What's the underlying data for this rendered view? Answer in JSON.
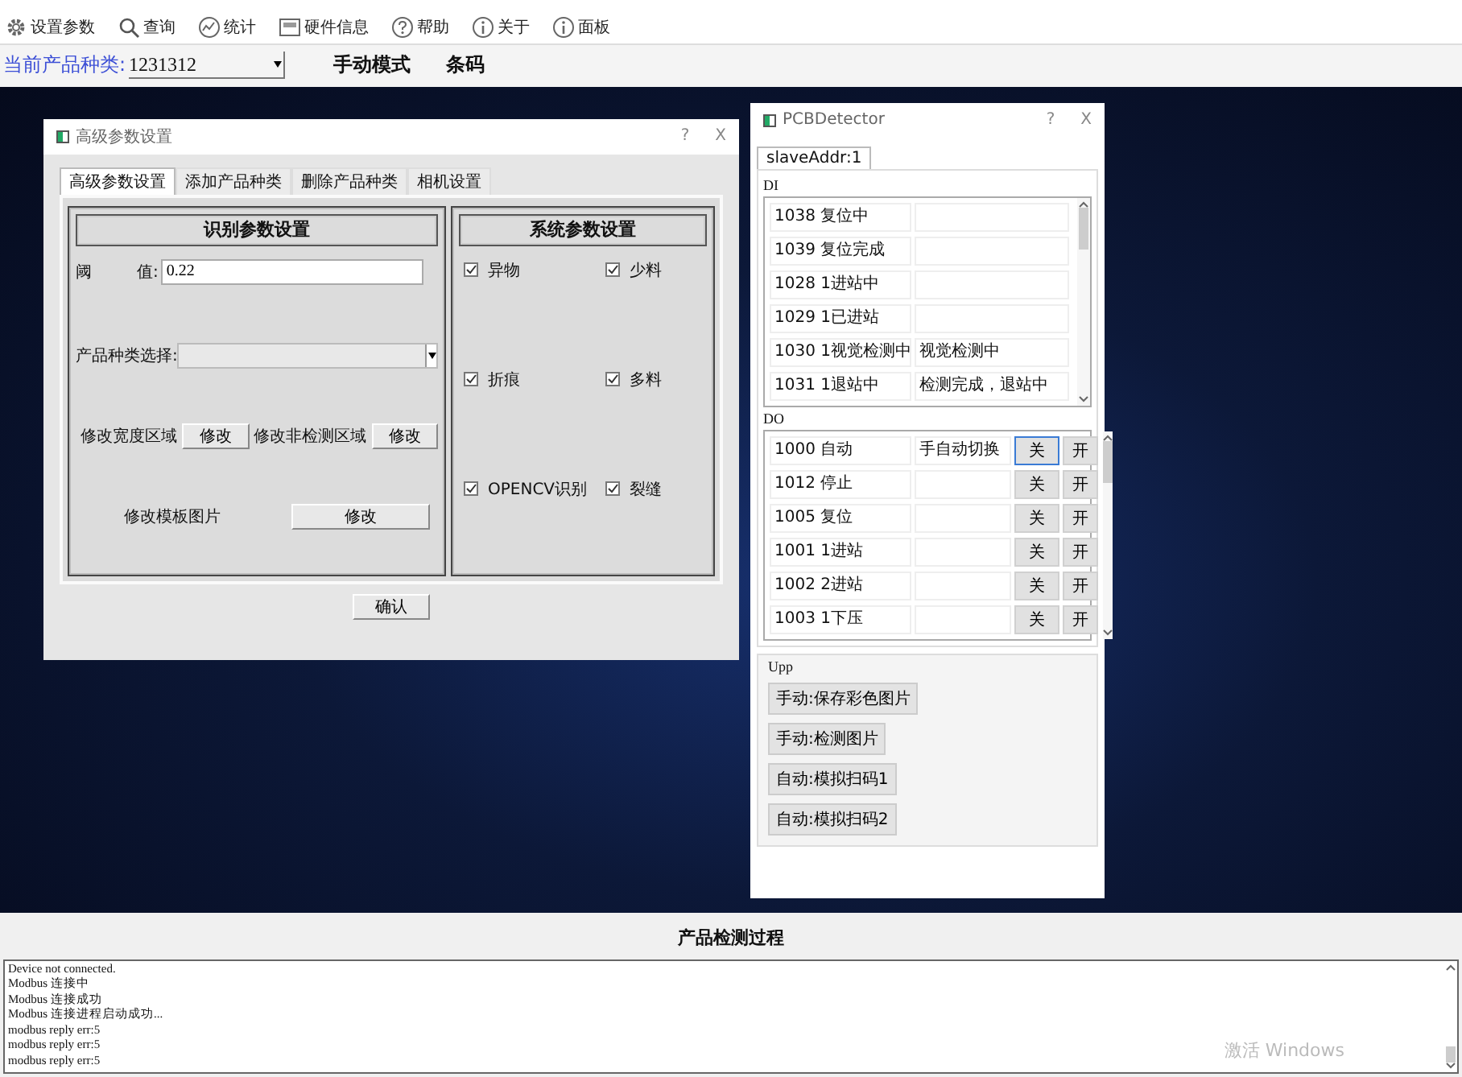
{
  "toolbar": [
    {
      "label": "设置参数"
    },
    {
      "label": "查询"
    },
    {
      "label": "统计"
    },
    {
      "label": "硬件信息"
    },
    {
      "label": "帮助"
    },
    {
      "label": "关于"
    },
    {
      "label": "面板"
    }
  ],
  "product_bar": {
    "label": "当前产品种类:",
    "value": "1231312",
    "mode": "手动模式",
    "barcode": "条码"
  },
  "settings_dialog": {
    "title": "高级参数设置",
    "help": "?",
    "close": "X",
    "tabs": [
      {
        "label": "高级参数设置",
        "selected": true
      },
      {
        "label": "添加产品种类",
        "selected": false
      },
      {
        "label": "删除产品种类",
        "selected": false
      },
      {
        "label": "相机设置",
        "selected": false
      }
    ],
    "left_panel": {
      "title": "识别参数设置",
      "threshold_label_start": "阈",
      "threshold_label_end": "值:",
      "threshold_value": "0.22",
      "product_type_label": "产品种类选择:",
      "width_area_label": "修改宽度区域",
      "width_area_button": "修改",
      "non_detect_label": "修改非检测区域",
      "non_detect_button": "修改",
      "template_label": "修改模板图片",
      "template_button": "修改"
    },
    "right_panel": {
      "title": "系统参数设置",
      "checkboxes": [
        {
          "label": "异物",
          "checked": true
        },
        {
          "label": "少料",
          "checked": true
        },
        {
          "label": "折痕",
          "checked": true
        },
        {
          "label": "多料",
          "checked": true
        },
        {
          "label": "OPENCV识别",
          "checked": true
        },
        {
          "label": "裂缝",
          "checked": true
        }
      ]
    },
    "confirm_button": "确认"
  },
  "pcb_window": {
    "title": "PCBDetector",
    "help": "?",
    "close": "X",
    "tabs": [
      {
        "label": "slaveAddr:1",
        "selected": true
      }
    ],
    "di_label": "DI",
    "di_rows": [
      {
        "label": "1038 复位中",
        "value": ""
      },
      {
        "label": "1039 复位完成",
        "value": ""
      },
      {
        "label": "1028 1进站中",
        "value": ""
      },
      {
        "label": "1029 1已进站",
        "value": ""
      },
      {
        "label": "1030 1视觉检测中",
        "value": "视觉检测中"
      },
      {
        "label": "1031 1退站中",
        "value": "检测完成，退站中"
      }
    ],
    "do_label": "DO",
    "do_rows": [
      {
        "label": "1000 自动",
        "value": "手自动切换",
        "off": "关",
        "on": "开",
        "focused": true
      },
      {
        "label": "1012 停止",
        "value": "",
        "off": "关",
        "on": "开",
        "focused": false
      },
      {
        "label": "1005 复位",
        "value": "",
        "off": "关",
        "on": "开",
        "focused": false
      },
      {
        "label": "1001 1进站",
        "value": "",
        "off": "关",
        "on": "开",
        "focused": false
      },
      {
        "label": "1002 2进站",
        "value": "",
        "off": "关",
        "on": "开",
        "focused": false
      },
      {
        "label": "1003 1下压",
        "value": "",
        "off": "关",
        "on": "开",
        "focused": false
      }
    ],
    "app_label": "Upp",
    "app_buttons": [
      "手动:保存彩色图片",
      "手动:检测图片",
      "自动:模拟扫码1",
      "自动:模拟扫码2"
    ]
  },
  "log": {
    "title": "产品检测过程",
    "lines": [
      "Device not connected.",
      "Modbus 连接中",
      "Modbus 连接成功",
      "Modbus 连接进程启动成功...",
      "modbus reply err:5",
      "modbus reply err:5",
      "modbus reply err:5"
    ]
  },
  "activation_notice": "激活 Windows"
}
